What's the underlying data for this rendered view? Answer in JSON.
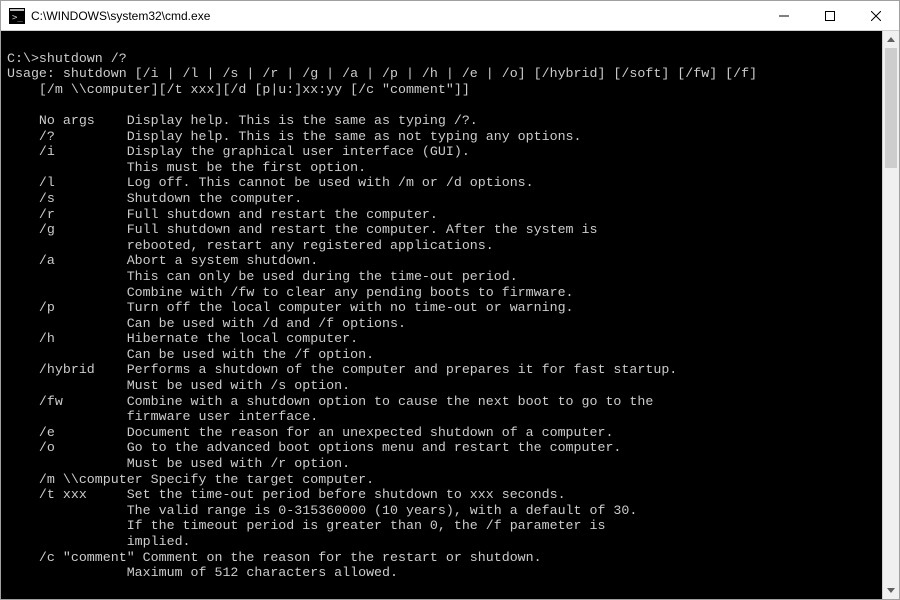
{
  "titlebar": {
    "title": "C:\\WINDOWS\\system32\\cmd.exe"
  },
  "console": {
    "prompt": "C:\\>shutdown /?",
    "usage1": "Usage: shutdown [/i | /l | /s | /r | /g | /a | /p | /h | /e | /o] [/hybrid] [/soft] [/fw] [/f]",
    "usage2": "    [/m \\\\computer][/t xxx][/d [p|u:]xx:yy [/c \"comment\"]]",
    "options": [
      {
        "flag": "    No args    ",
        "text": "Display help. This is the same as typing /?."
      },
      {
        "flag": "    /?         ",
        "text": "Display help. This is the same as not typing any options."
      },
      {
        "flag": "    /i         ",
        "text": "Display the graphical user interface (GUI)."
      },
      {
        "flag": "               ",
        "text": "This must be the first option."
      },
      {
        "flag": "    /l         ",
        "text": "Log off. This cannot be used with /m or /d options."
      },
      {
        "flag": "    /s         ",
        "text": "Shutdown the computer."
      },
      {
        "flag": "    /r         ",
        "text": "Full shutdown and restart the computer."
      },
      {
        "flag": "    /g         ",
        "text": "Full shutdown and restart the computer. After the system is"
      },
      {
        "flag": "               ",
        "text": "rebooted, restart any registered applications."
      },
      {
        "flag": "    /a         ",
        "text": "Abort a system shutdown."
      },
      {
        "flag": "               ",
        "text": "This can only be used during the time-out period."
      },
      {
        "flag": "               ",
        "text": "Combine with /fw to clear any pending boots to firmware."
      },
      {
        "flag": "    /p         ",
        "text": "Turn off the local computer with no time-out or warning."
      },
      {
        "flag": "               ",
        "text": "Can be used with /d and /f options."
      },
      {
        "flag": "    /h         ",
        "text": "Hibernate the local computer."
      },
      {
        "flag": "               ",
        "text": "Can be used with the /f option."
      },
      {
        "flag": "    /hybrid    ",
        "text": "Performs a shutdown of the computer and prepares it for fast startup."
      },
      {
        "flag": "               ",
        "text": "Must be used with /s option."
      },
      {
        "flag": "    /fw        ",
        "text": "Combine with a shutdown option to cause the next boot to go to the"
      },
      {
        "flag": "               ",
        "text": "firmware user interface."
      },
      {
        "flag": "    /e         ",
        "text": "Document the reason for an unexpected shutdown of a computer."
      },
      {
        "flag": "    /o         ",
        "text": "Go to the advanced boot options menu and restart the computer."
      },
      {
        "flag": "               ",
        "text": "Must be used with /r option."
      },
      {
        "flag": "    /m \\\\computer ",
        "text": "Specify the target computer."
      },
      {
        "flag": "    /t xxx     ",
        "text": "Set the time-out period before shutdown to xxx seconds."
      },
      {
        "flag": "               ",
        "text": "The valid range is 0-315360000 (10 years), with a default of 30."
      },
      {
        "flag": "               ",
        "text": "If the timeout period is greater than 0, the /f parameter is"
      },
      {
        "flag": "               ",
        "text": "implied."
      },
      {
        "flag": "    /c \"comment\" ",
        "text": "Comment on the reason for the restart or shutdown."
      },
      {
        "flag": "               ",
        "text": "Maximum of 512 characters allowed."
      }
    ]
  }
}
